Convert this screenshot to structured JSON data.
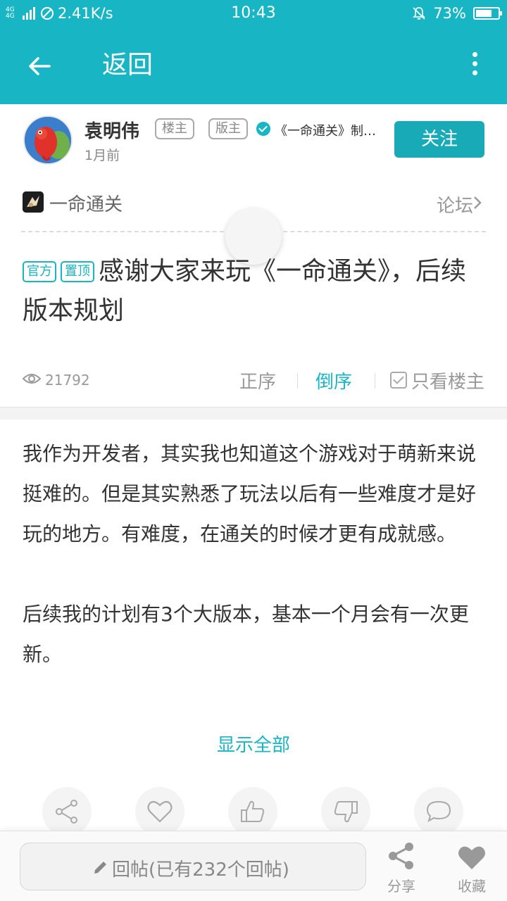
{
  "status_bar": {
    "network_label": "4G 4G",
    "speed": "2.41K/s",
    "time": "10:43",
    "battery": "73%",
    "battery_level": 0.73
  },
  "app_bar": {
    "title": "返回"
  },
  "author": {
    "name": "袁明伟",
    "tag_owner": "楼主",
    "tag_moderator": "版主",
    "description": "《一命通关》制作人",
    "time": "1月前",
    "follow_label": "关注"
  },
  "forum": {
    "name": "一命通关",
    "link_label": "论坛"
  },
  "post": {
    "tag_official": "官方",
    "tag_pinned": "置顶",
    "title": "感谢大家来玩《一命通关》，后续版本规划",
    "views": "21792",
    "sort_asc": "正序",
    "sort_desc": "倒序",
    "only_op": "只看楼主",
    "paragraph_1": "我作为开发者，其实我也知道这个游戏对于萌新来说挺难的。但是其实熟悉了玩法以后有一些难度才是好玩的地方。有难度，在通关的时候才更有成就感。",
    "paragraph_2": "后续我的计划有3个大版本，基本一个月会有一次更新。",
    "show_all": "显示全部"
  },
  "actions": [
    "share-icon",
    "heart-icon",
    "thumbs-up-icon",
    "thumbs-down-icon",
    "comment-icon"
  ],
  "bottom_bar": {
    "reply_placeholder": "回帖(已有232个回帖)",
    "share_label": "分享",
    "favorite_label": "收藏"
  },
  "colors": {
    "accent": "#18b5c4",
    "follow_button": "#18aab7"
  }
}
